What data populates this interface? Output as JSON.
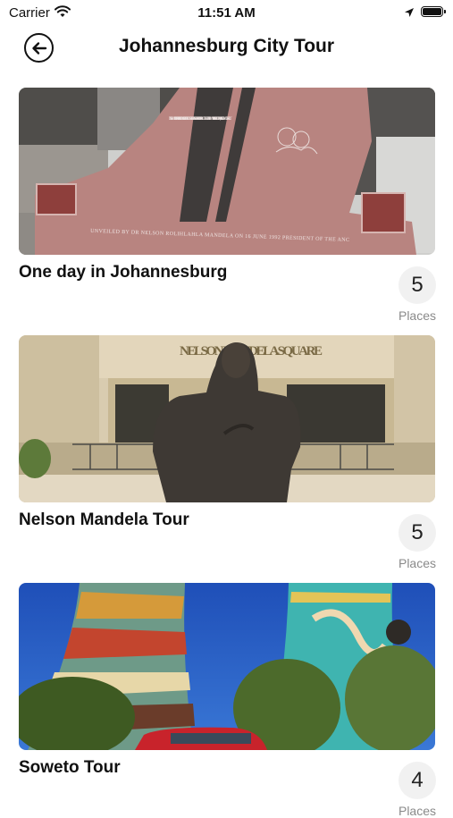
{
  "status_bar": {
    "carrier": "Carrier",
    "time": "11:51 AM"
  },
  "header": {
    "title": "Johannesburg City Tour"
  },
  "tours": [
    {
      "title": "One day in Johannesburg",
      "count": "5",
      "count_label": "Places",
      "image_icon": "memorial-photo"
    },
    {
      "title": "Nelson Mandela Tour",
      "count": "5",
      "count_label": "Places",
      "image_icon": "statue-photo"
    },
    {
      "title": "Soweto Tour",
      "count": "4",
      "count_label": "Places",
      "image_icon": "towers-photo"
    }
  ],
  "image_text": {
    "memorial_plaque": "IN MEMORY OF HECTOR PIETERSON AND ALL OTHER YOUNG HEROES AND HEROINES OF OUR STRUGGLE WHO LAID DOWN THEIR LIVES FOR FREEDOM, PEACE AND DEMOCRACY",
    "memorial_base": "UNVEILED BY DR NELSON ROLIHLAHLA MANDELA ON 16 JUNE 1992 PRESIDENT OF THE ANC",
    "square_sign": "NELSON MANDELA SQUARE"
  }
}
